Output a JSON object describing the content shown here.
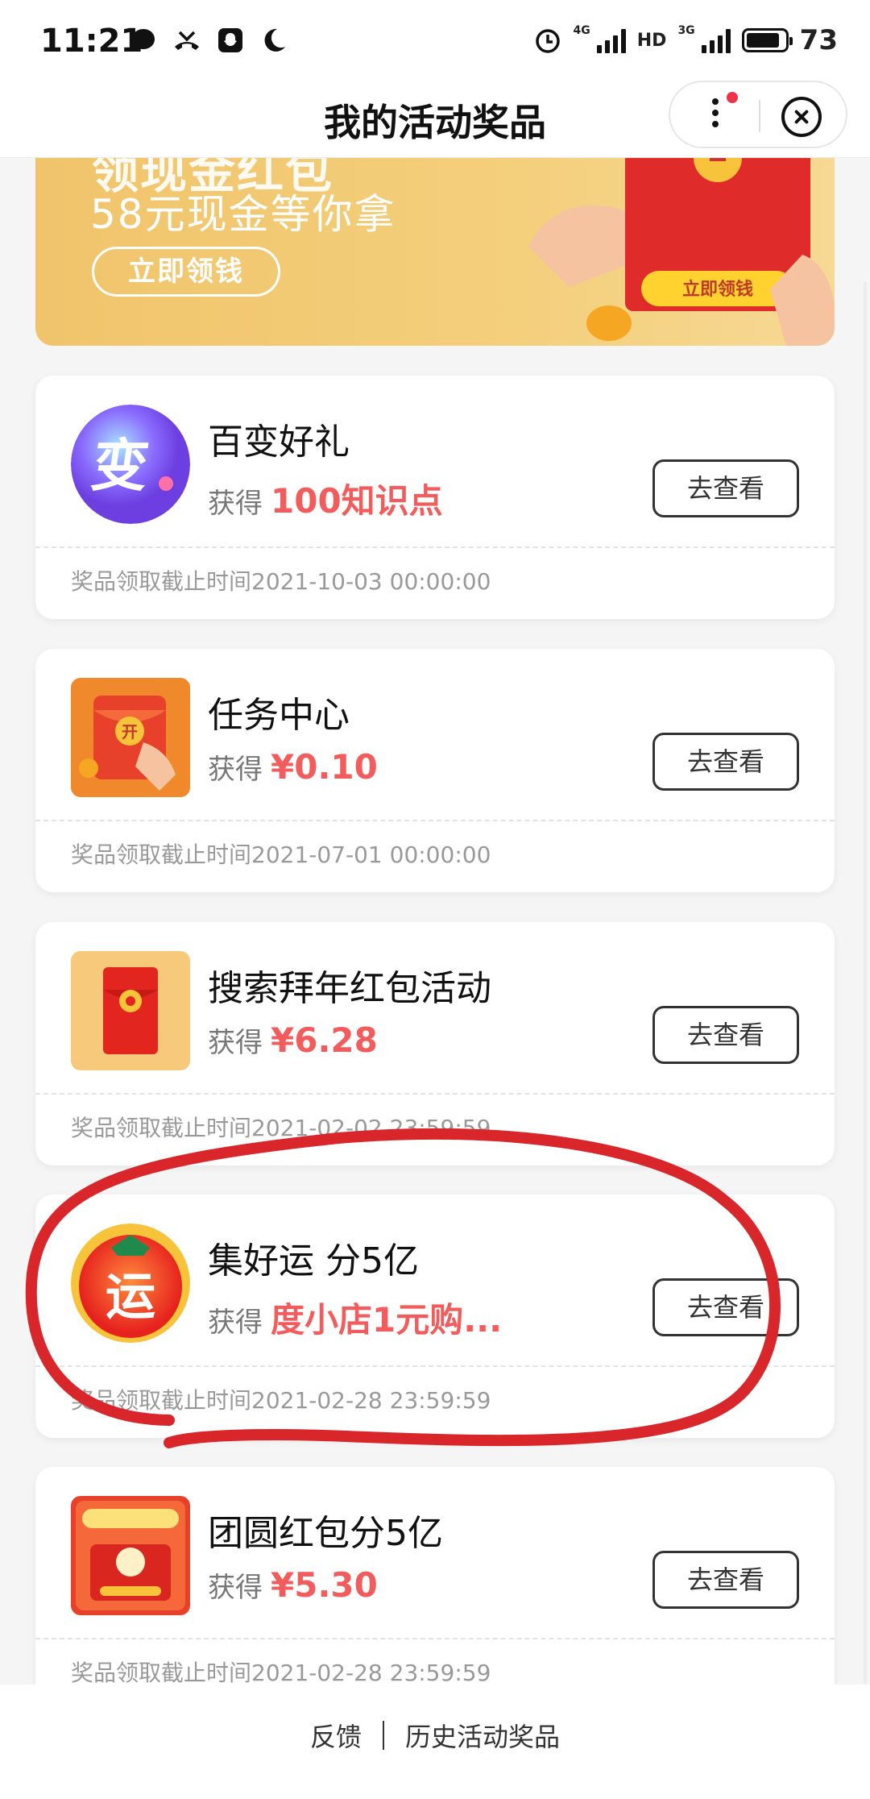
{
  "status_bar": {
    "time": "11:21",
    "battery": "73",
    "net1": "4G",
    "net2": "HD",
    "net3": "3G"
  },
  "header": {
    "title": "我的活动奖品"
  },
  "banner": {
    "headline_partial": "领现金红包",
    "subtitle": "58元现金等你拿",
    "button": "立即领钱",
    "art_button": "立即领钱"
  },
  "cards": [
    {
      "name": "百变好礼",
      "gain_label": "获得",
      "amount": "100知识点",
      "button": "去查看",
      "deadline": "奖品领取截止时间2021-10-03 00:00:00",
      "icon": "bianhaoli-icon"
    },
    {
      "name": "任务中心",
      "gain_label": "获得",
      "amount": "¥0.10",
      "button": "去查看",
      "deadline": "奖品领取截止时间2021-07-01 00:00:00",
      "icon": "red-envelope-open-icon"
    },
    {
      "name": "搜索拜年红包活动",
      "gain_label": "获得",
      "amount": "¥6.28",
      "button": "去查看",
      "deadline": "奖品领取截止时间2021-02-02 23:59:59",
      "icon": "red-envelope-icon"
    },
    {
      "name": "集好运 分5亿",
      "gain_label": "获得",
      "amount": "度小店1元购...",
      "button": "去查看",
      "deadline": "奖品领取截止时间2021-02-28 23:59:59",
      "icon": "lucky-bag-icon"
    },
    {
      "name": "团圆红包分5亿",
      "gain_label": "获得",
      "amount": "¥5.30",
      "button": "去查看",
      "deadline": "奖品领取截止时间2021-02-28 23:59:59",
      "icon": "tuanyuan-icon"
    }
  ],
  "footer": {
    "feedback": "反馈",
    "history": "历史活动奖品"
  },
  "colors": {
    "amount": "#f25c5c",
    "annotation": "#d8262a",
    "banner": "#f3cb77"
  }
}
